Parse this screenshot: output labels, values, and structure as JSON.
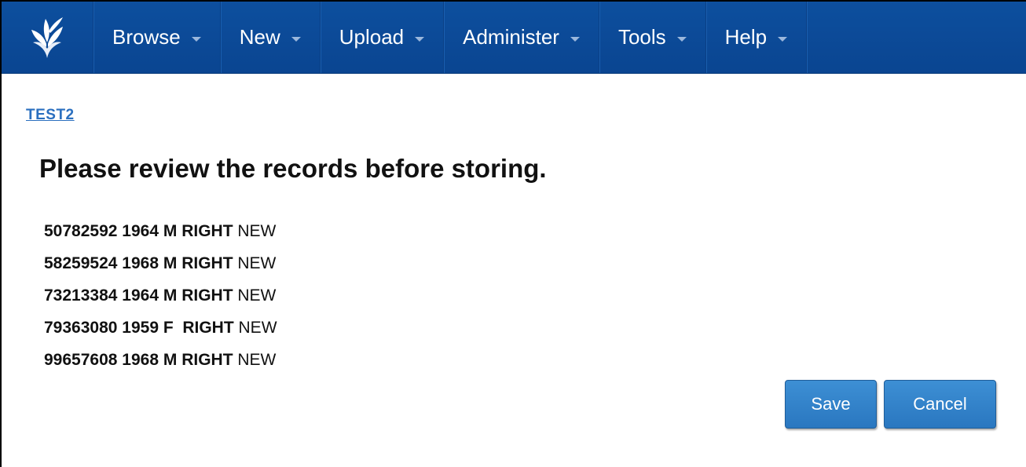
{
  "nav": {
    "items": [
      {
        "label": "Browse"
      },
      {
        "label": "New"
      },
      {
        "label": "Upload"
      },
      {
        "label": "Administer"
      },
      {
        "label": "Tools"
      },
      {
        "label": "Help"
      }
    ],
    "logo_icon": "leaf-logo-icon",
    "caret_icon": "caret-down-icon"
  },
  "breadcrumb": {
    "link": "TEST2"
  },
  "page": {
    "title": "Please review the records before storing."
  },
  "records": [
    {
      "id": "50782592",
      "year": "1964",
      "sex": "M",
      "side": "RIGHT",
      "status": "NEW"
    },
    {
      "id": "58259524",
      "year": "1968",
      "sex": "M",
      "side": "RIGHT",
      "status": "NEW"
    },
    {
      "id": "73213384",
      "year": "1964",
      "sex": "M",
      "side": "RIGHT",
      "status": "NEW"
    },
    {
      "id": "79363080",
      "year": "1959",
      "sex": "F",
      "side": "RIGHT",
      "status": "NEW"
    },
    {
      "id": "99657608",
      "year": "1968",
      "sex": "M",
      "side": "RIGHT",
      "status": "NEW"
    }
  ],
  "actions": {
    "save_label": "Save",
    "cancel_label": "Cancel"
  },
  "colors": {
    "navbar": "#0d4f9e",
    "button": "#2a77c0",
    "link": "#2a6fbf"
  }
}
